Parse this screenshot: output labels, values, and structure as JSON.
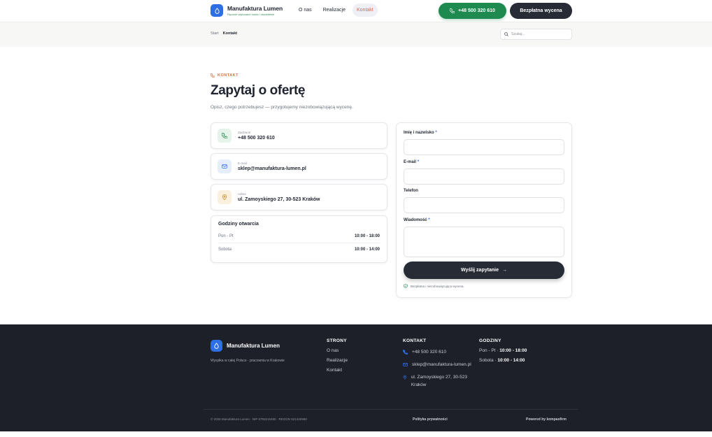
{
  "header": {
    "brand_name": "Manufaktura Lumen",
    "brand_tagline": "Ręcznie wykonane lustra i oświetlenie",
    "nav": [
      {
        "label": "O nas"
      },
      {
        "label": "Realizacje"
      },
      {
        "label": "Kontakt"
      }
    ],
    "phone_button": "+48 500 320 610",
    "quote_button": "Bezpłatna wycena"
  },
  "breadcrumb": {
    "items": [
      "Start",
      "Kontakt"
    ]
  },
  "search": {
    "placeholder": "Szukaj..."
  },
  "main": {
    "eyebrow": "KONTAKT",
    "title": "Zapytaj o ofertę",
    "lead": "Opisz, czego potrzebujesz — przygotujemy niezobowiązującą wycenę.",
    "contacts": [
      {
        "label": "Zadzwoń",
        "value": "+48 500 320 610",
        "icon": "phone-icon"
      },
      {
        "label": "E-mail",
        "value": "sklep@manufaktura-lumen.pl",
        "icon": "mail-icon"
      },
      {
        "label": "Adres",
        "value": "ul. Zamoyskiego 27, 30-523 Kraków",
        "icon": "map-pin-icon"
      }
    ],
    "hours": {
      "title": "Godziny otwarcia",
      "rows": [
        {
          "day": "Pon - Pt",
          "time": "10:00 - 18:00"
        },
        {
          "day": "Sobota",
          "time": "10:00 - 14:00"
        }
      ]
    }
  },
  "form": {
    "name_label": "Imię i nazwisko",
    "email_label": "E-mail",
    "phone_label": "Telefon",
    "message_label": "Wiadomość",
    "required_mark": "*",
    "submit_label": "Wyślij zapytanie",
    "note": "Bezpłatna i niezobowiązująca wycena."
  },
  "footer": {
    "brand_name": "Manufaktura Lumen",
    "tagline": "Wysyłka w całej Polsce · pracownia w Krakowie",
    "pages_heading": "STRONY",
    "pages": [
      "O nas",
      "Realizacje",
      "Kontakt"
    ],
    "contact_heading": "KONTAKT",
    "contact_phone": "+48 500 320 610",
    "contact_email": "sklep@manufaktura-lumen.pl",
    "contact_address": "ul. Zamoyskiego 27, 30-523 Kraków",
    "hours_heading": "GODZINY",
    "hours": [
      {
        "day": "Pon - Pt ·",
        "time": "10:00 - 18:00"
      },
      {
        "day": "Sobota ·",
        "time": "10:00 - 14:00"
      }
    ],
    "copyright": "© 2026 Manufaktura Lumen · NIP 6793215480 · REGON 521440980",
    "privacy": "Polityka prywatności",
    "powered": "Powered by kompasfirm"
  },
  "colors": {
    "accent": "#2f6fe6",
    "phone_green": "#1e8a4f",
    "eyebrow_orange": "#d96b3b",
    "dark": "#262b35",
    "footer_bg": "#1d2028"
  }
}
